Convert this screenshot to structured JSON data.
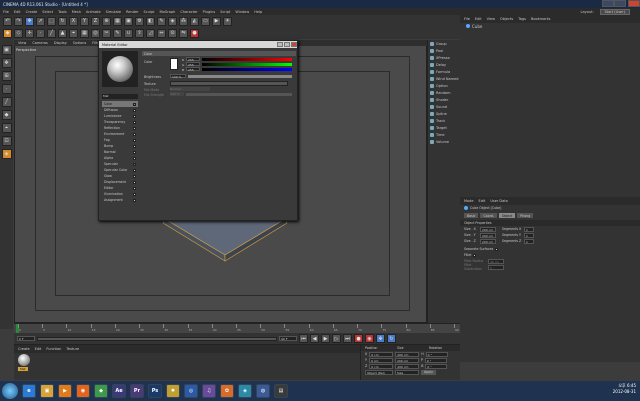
{
  "window": {
    "title": "CINEMA 4D R13.061 Studio - [Untitled 4 *]"
  },
  "menubar": {
    "items": [
      "File",
      "Edit",
      "Create",
      "Select",
      "Tools",
      "Mesh",
      "Animate",
      "Simulate",
      "Render",
      "Sculpt",
      "MoGraph",
      "Character",
      "Plugins",
      "Script",
      "Window",
      "Help"
    ],
    "layout_label": "Layout:",
    "layout_value": "Start (User)"
  },
  "viewport": {
    "menu": [
      "View",
      "Cameras",
      "Display",
      "Options",
      "Filter",
      "Panel"
    ],
    "label": "Perspective"
  },
  "object_manager": {
    "menu": [
      "File",
      "Edit",
      "View",
      "Objects",
      "Tags",
      "Bookmarks"
    ],
    "objects": [
      "Cube"
    ]
  },
  "palette": {
    "items": [
      "Group",
      "Pool",
      "XPresso",
      "Delay",
      "Formula",
      "Wind Named",
      "Option",
      "Random",
      "Shader",
      "Sound",
      "Spline",
      "Track",
      "Target",
      "Time",
      "Volume"
    ]
  },
  "material_editor": {
    "title": "Material Editor",
    "material_name": "Mat",
    "header": "Color",
    "color_label": "Color",
    "r": "255",
    "g": "255",
    "b": "255",
    "brightness_label": "Brightness",
    "brightness_value": "100 %",
    "texture_label": "Texture",
    "mix_mode_label": "Mix Mode",
    "mix_mode_value": "Normal",
    "mix_strength_label": "Mix Strength",
    "mix_strength_value": "100 %",
    "channels": [
      {
        "label": "Color",
        "checked": true
      },
      {
        "label": "Diffusion",
        "checked": false
      },
      {
        "label": "Luminance",
        "checked": false
      },
      {
        "label": "Transparency",
        "checked": false
      },
      {
        "label": "Reflection",
        "checked": false
      },
      {
        "label": "Environment",
        "checked": false
      },
      {
        "label": "Fog",
        "checked": false
      },
      {
        "label": "Bump",
        "checked": false
      },
      {
        "label": "Normal",
        "checked": false
      },
      {
        "label": "Alpha",
        "checked": false
      },
      {
        "label": "Specular",
        "checked": true
      },
      {
        "label": "Specular Color",
        "checked": false
      },
      {
        "label": "Glow",
        "checked": false
      },
      {
        "label": "Displacement",
        "checked": false
      },
      {
        "label": "Editor",
        "checked": false
      },
      {
        "label": "Illumination",
        "checked": false
      },
      {
        "label": "Assignment",
        "checked": false
      }
    ]
  },
  "attributes": {
    "menu": [
      "Mode",
      "Edit",
      "User Data"
    ],
    "object_title": "Cube Object [Cube]",
    "tabs": [
      "Basic",
      "Coord.",
      "Object",
      "Phong"
    ],
    "active_tab": "Object",
    "section": "Object Properties",
    "size_x_label": "Size . X",
    "size_x": "200 cm",
    "size_y_label": "Size . Y",
    "size_y": "200 cm",
    "size_z_label": "Size . Z",
    "size_z": "200 cm",
    "seg_x_label": "Segments X",
    "seg_x": "1",
    "seg_y_label": "Segments Y",
    "seg_y": "1",
    "seg_z_label": "Segments Z",
    "seg_z": "1",
    "separate_label": "Separate Surfaces",
    "fillet_label": "Fillet",
    "fillet_radius_label": "Fillet Radius",
    "fillet_radius": "40 cm",
    "fillet_sub_label": "Fillet Subdivision",
    "fillet_sub": "5"
  },
  "timeline": {
    "ticks": [
      "0",
      "5",
      "10",
      "15",
      "20",
      "25",
      "30",
      "35",
      "40",
      "45",
      "50",
      "55",
      "60",
      "65",
      "70",
      "75",
      "80",
      "85",
      "90"
    ],
    "current_frame": "0 F",
    "start_frame": "0 F",
    "end_frame": "90 F"
  },
  "material_manager": {
    "menu": [
      "Create",
      "Edit",
      "Function",
      "Texture"
    ],
    "material_name": "Mat"
  },
  "coordinates": {
    "headers": [
      "Position",
      "Size",
      "Rotation"
    ],
    "rows": [
      {
        "axis": "X",
        "pos": "0 cm",
        "size": "200 cm",
        "rot_label": "H",
        "rot": "0 °"
      },
      {
        "axis": "Y",
        "pos": "0 cm",
        "size": "200 cm",
        "rot_label": "P",
        "rot": "0 °"
      },
      {
        "axis": "Z",
        "pos": "0 cm",
        "size": "200 cm",
        "rot_label": "B",
        "rot": "0 °"
      }
    ],
    "mode": "Object (Rel)",
    "size_mode": "Size",
    "apply": "Apply"
  },
  "taskbar": {
    "apps": [
      {
        "name": "internet-explorer",
        "glyph": "e",
        "color": "#2a7bd8"
      },
      {
        "name": "explorer",
        "glyph": "▣",
        "color": "#d8a23a"
      },
      {
        "name": "media-player",
        "glyph": "▶",
        "color": "#e07a1a"
      },
      {
        "name": "firefox",
        "glyph": "◉",
        "color": "#e3641c"
      },
      {
        "name": "app-green",
        "glyph": "◆",
        "color": "#3c9a4a"
      },
      {
        "name": "after-effects",
        "glyph": "Ae",
        "color": "#3a3a7a"
      },
      {
        "name": "premiere",
        "glyph": "Pr",
        "color": "#4a3a7a"
      },
      {
        "name": "photoshop",
        "glyph": "Ps",
        "color": "#1a3a6a"
      },
      {
        "name": "app-sun",
        "glyph": "✸",
        "color": "#c0a030"
      },
      {
        "name": "app-blue",
        "glyph": "◎",
        "color": "#2a5aa8"
      },
      {
        "name": "app-media",
        "glyph": "♫",
        "color": "#6a4a9a"
      },
      {
        "name": "app-orange",
        "glyph": "✿",
        "color": "#d86a2a"
      },
      {
        "name": "app-cyan",
        "glyph": "◈",
        "color": "#2a8aa8"
      },
      {
        "name": "cinema4d",
        "glyph": "◍",
        "color": "#3a5a9a"
      },
      {
        "name": "app-dark",
        "glyph": "▤",
        "color": "#3a3a3a"
      }
    ],
    "time": "오후 6:45",
    "date": "2012-08-31"
  },
  "colors": {
    "accent_blue": "#4a7ac8",
    "titlebar": "#1a2a44",
    "taskbar": "#1f3350"
  }
}
